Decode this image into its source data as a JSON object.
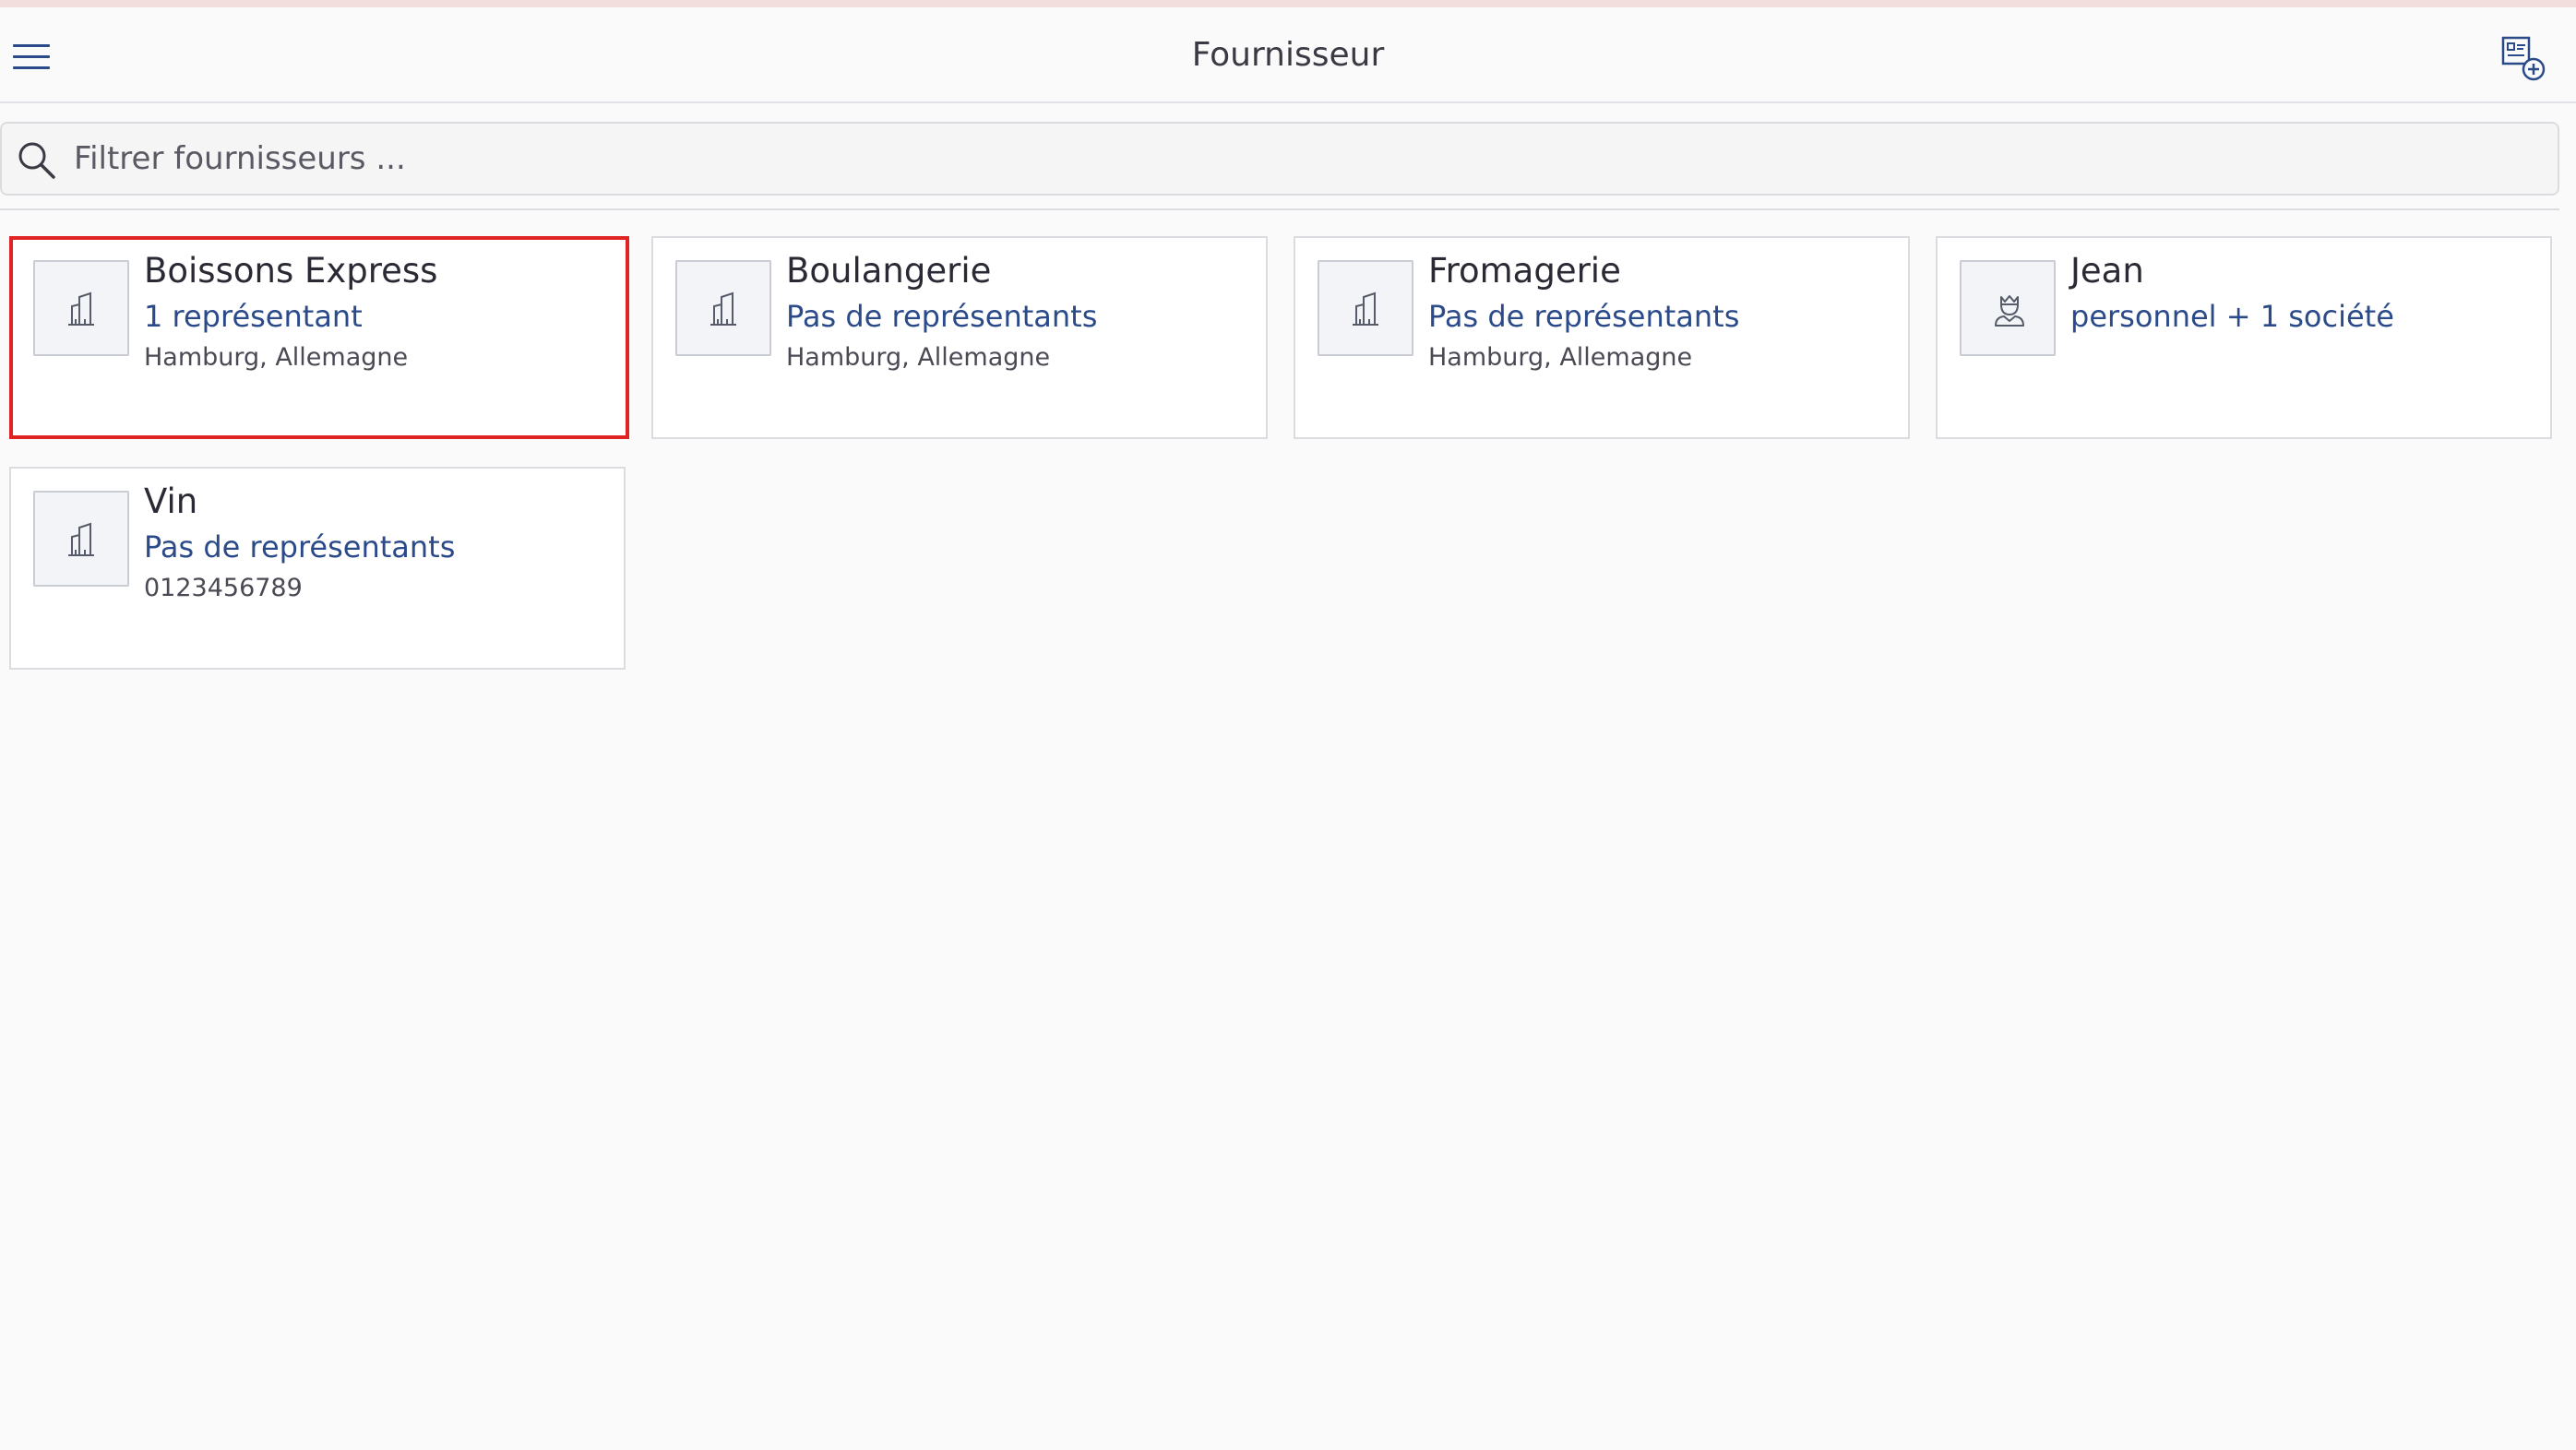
{
  "header": {
    "title": "Fournisseur",
    "menu_icon": "hamburger-menu-icon",
    "add_icon": "add-contact-icon"
  },
  "search": {
    "placeholder": "Filtrer fournisseurs ...",
    "value": ""
  },
  "colors": {
    "accent": "#2b4a8a",
    "selection": "#e02424",
    "background": "#fafafa",
    "card": "#ffffff"
  },
  "suppliers": [
    {
      "name": "Boissons Express",
      "subtitle": "1 représentant",
      "detail": "Hamburg, Allemagne",
      "icon": "building-icon",
      "selected": true
    },
    {
      "name": "Boulangerie",
      "subtitle": "Pas de représentants",
      "detail": "Hamburg, Allemagne",
      "icon": "building-icon",
      "selected": false
    },
    {
      "name": "Fromagerie",
      "subtitle": "Pas de représentants",
      "detail": "Hamburg, Allemagne",
      "icon": "building-icon",
      "selected": false
    },
    {
      "name": "Jean",
      "subtitle": "personnel + 1 société",
      "detail": "",
      "icon": "person-icon",
      "selected": false
    },
    {
      "name": "Vin",
      "subtitle": "Pas de représentants",
      "detail": "0123456789",
      "icon": "building-icon",
      "selected": false
    }
  ]
}
